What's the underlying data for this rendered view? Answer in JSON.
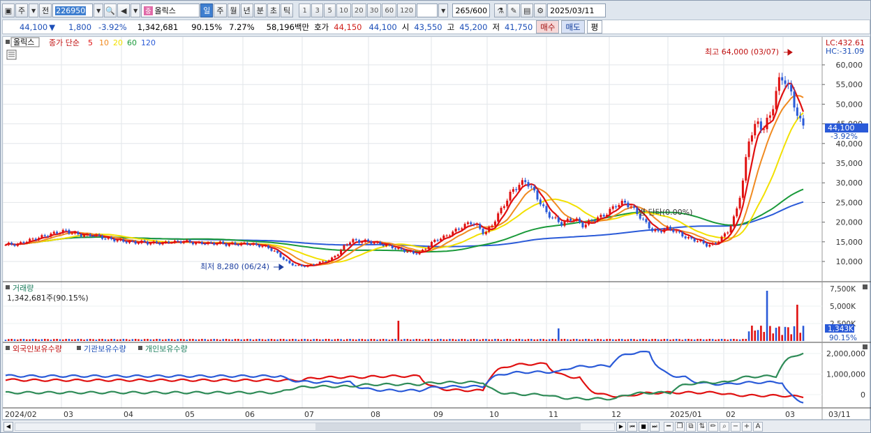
{
  "toolbar": {
    "type_label": "주",
    "prev_label": "전",
    "stock_code": "226950",
    "stock_name": "올릭스",
    "periods": [
      "일",
      "주",
      "월",
      "년",
      "분",
      "초",
      "틱"
    ],
    "intervals": [
      "1",
      "3",
      "5",
      "10",
      "20",
      "30",
      "60",
      "120"
    ],
    "count": "265",
    "count_max": "/600",
    "date": "2025/03/11"
  },
  "info": {
    "price": "44,100",
    "arrow": "▼",
    "change": "1,800",
    "change_pct": "-3.92%",
    "volume": "1,342,681",
    "vol_ratio": "90.15%",
    "turnover": "7.27%",
    "amount": "58,196백만",
    "bid_label": "호가",
    "bid1": "44,150",
    "bid2": "44,100",
    "open_label": "시",
    "open": "43,550",
    "high_label": "고",
    "high": "45,200",
    "low_label": "저",
    "low": "41,750",
    "buy": "매수",
    "sell": "매도",
    "eval": "평"
  },
  "chart": {
    "legend_name": "올릭스",
    "legend_type": "종가 단순",
    "ma": [
      "5",
      "10",
      "20",
      "60",
      "120"
    ],
    "ma_colors": [
      "#e01010",
      "#f08a20",
      "#f2e000",
      "#1a9a3a",
      "#2a5ad8"
    ],
    "lc": "LC:432.61",
    "hc": "HC:-31.09",
    "high_annot": "최고 64,000 (03/07)",
    "low_annot": "최저 8,280 (06/24)",
    "mid_annot": "뱅 단타(0.00%)",
    "price_axis": [
      "60,000",
      "55,000",
      "50,000",
      "45,000",
      "40,000",
      "35,000",
      "30,000",
      "25,000",
      "20,000",
      "15,000",
      "10,000"
    ],
    "price_tag": "44,100",
    "price_tag_pct": "-3.92%",
    "vol_title": "거래량",
    "vol_value": "1,342,681주(90.15%)",
    "vol_axis": [
      "7,500K",
      "5,000K",
      "2,500K"
    ],
    "vol_tag": "1,343K",
    "vol_pct": "90.15%",
    "hold_titles": [
      "외국인보유수량",
      "기관보유수량",
      "개인보유수량"
    ],
    "hold_colors": [
      "#e01010",
      "#2a5ad8",
      "#2e8b57"
    ],
    "hold_axis": [
      "2,000,000",
      "1,000,000",
      "0"
    ],
    "dates": [
      "2024/02",
      "03",
      "04",
      "05",
      "06",
      "07",
      "08",
      "09",
      "10",
      "11",
      "12",
      "2025/01",
      "02",
      "03",
      "03/11"
    ]
  },
  "chart_data": {
    "type": "line",
    "title": "",
    "ylim": [
      5000,
      66000
    ],
    "points": [
      [
        0,
        14000
      ],
      [
        10,
        14500
      ],
      [
        20,
        14200
      ],
      [
        30,
        15000
      ],
      [
        40,
        15500
      ],
      [
        50,
        16000
      ],
      [
        60,
        16500
      ],
      [
        70,
        17000
      ],
      [
        80,
        17500
      ],
      [
        90,
        17800
      ],
      [
        100,
        17200
      ],
      [
        110,
        16800
      ],
      [
        120,
        16500
      ],
      [
        130,
        16800
      ],
      [
        140,
        16200
      ],
      [
        150,
        15800
      ],
      [
        160,
        15500
      ],
      [
        170,
        15200
      ],
      [
        180,
        15000
      ],
      [
        190,
        14800
      ],
      [
        200,
        15000
      ],
      [
        210,
        14600
      ],
      [
        220,
        14800
      ],
      [
        230,
        14600
      ],
      [
        240,
        15100
      ],
      [
        250,
        14900
      ],
      [
        260,
        15200
      ],
      [
        270,
        14800
      ],
      [
        280,
        14600
      ],
      [
        290,
        14700
      ],
      [
        300,
        14500
      ],
      [
        310,
        14800
      ],
      [
        320,
        14300
      ],
      [
        330,
        14500
      ],
      [
        340,
        14400
      ],
      [
        350,
        14600
      ],
      [
        360,
        14200
      ],
      [
        370,
        14000
      ],
      [
        380,
        13500
      ],
      [
        390,
        12500
      ],
      [
        400,
        11000
      ],
      [
        410,
        9500
      ],
      [
        420,
        9000
      ],
      [
        430,
        8800
      ],
      [
        440,
        9000
      ],
      [
        450,
        9500
      ],
      [
        460,
        10000
      ],
      [
        470,
        10500
      ],
      [
        480,
        12000
      ],
      [
        490,
        14000
      ],
      [
        500,
        15500
      ],
      [
        510,
        15000
      ],
      [
        520,
        15200
      ],
      [
        530,
        14800
      ],
      [
        540,
        14500
      ],
      [
        550,
        14000
      ],
      [
        560,
        13500
      ],
      [
        570,
        13000
      ],
      [
        580,
        12500
      ],
      [
        590,
        12000
      ],
      [
        600,
        12500
      ],
      [
        610,
        14000
      ],
      [
        620,
        15500
      ],
      [
        630,
        16000
      ],
      [
        640,
        17000
      ],
      [
        650,
        18000
      ],
      [
        660,
        19000
      ],
      [
        670,
        20000
      ],
      [
        680,
        19000
      ],
      [
        690,
        17000
      ],
      [
        700,
        19000
      ],
      [
        710,
        22000
      ],
      [
        720,
        25000
      ],
      [
        730,
        28000
      ],
      [
        740,
        29500
      ],
      [
        750,
        30500
      ],
      [
        760,
        28000
      ],
      [
        770,
        25000
      ],
      [
        780,
        22000
      ],
      [
        790,
        21000
      ],
      [
        800,
        19500
      ],
      [
        810,
        20500
      ],
      [
        820,
        21000
      ],
      [
        830,
        19000
      ],
      [
        840,
        20000
      ],
      [
        850,
        21000
      ],
      [
        860,
        21500
      ],
      [
        870,
        23000
      ],
      [
        880,
        24500
      ],
      [
        890,
        25000
      ],
      [
        900,
        24000
      ],
      [
        910,
        22000
      ],
      [
        920,
        20000
      ],
      [
        930,
        18000
      ],
      [
        940,
        17500
      ],
      [
        950,
        18500
      ],
      [
        960,
        18000
      ],
      [
        970,
        17000
      ],
      [
        980,
        16000
      ],
      [
        990,
        15500
      ],
      [
        1000,
        15000
      ],
      [
        1010,
        14000
      ],
      [
        1020,
        14500
      ],
      [
        1030,
        16000
      ],
      [
        1040,
        18000
      ],
      [
        1050,
        22000
      ],
      [
        1060,
        30000
      ],
      [
        1070,
        42000
      ],
      [
        1080,
        45000
      ],
      [
        1090,
        44000
      ],
      [
        1100,
        47000
      ],
      [
        1110,
        55000
      ],
      [
        1120,
        57000
      ],
      [
        1130,
        52000
      ],
      [
        1140,
        47000
      ],
      [
        1145,
        44100
      ]
    ]
  }
}
